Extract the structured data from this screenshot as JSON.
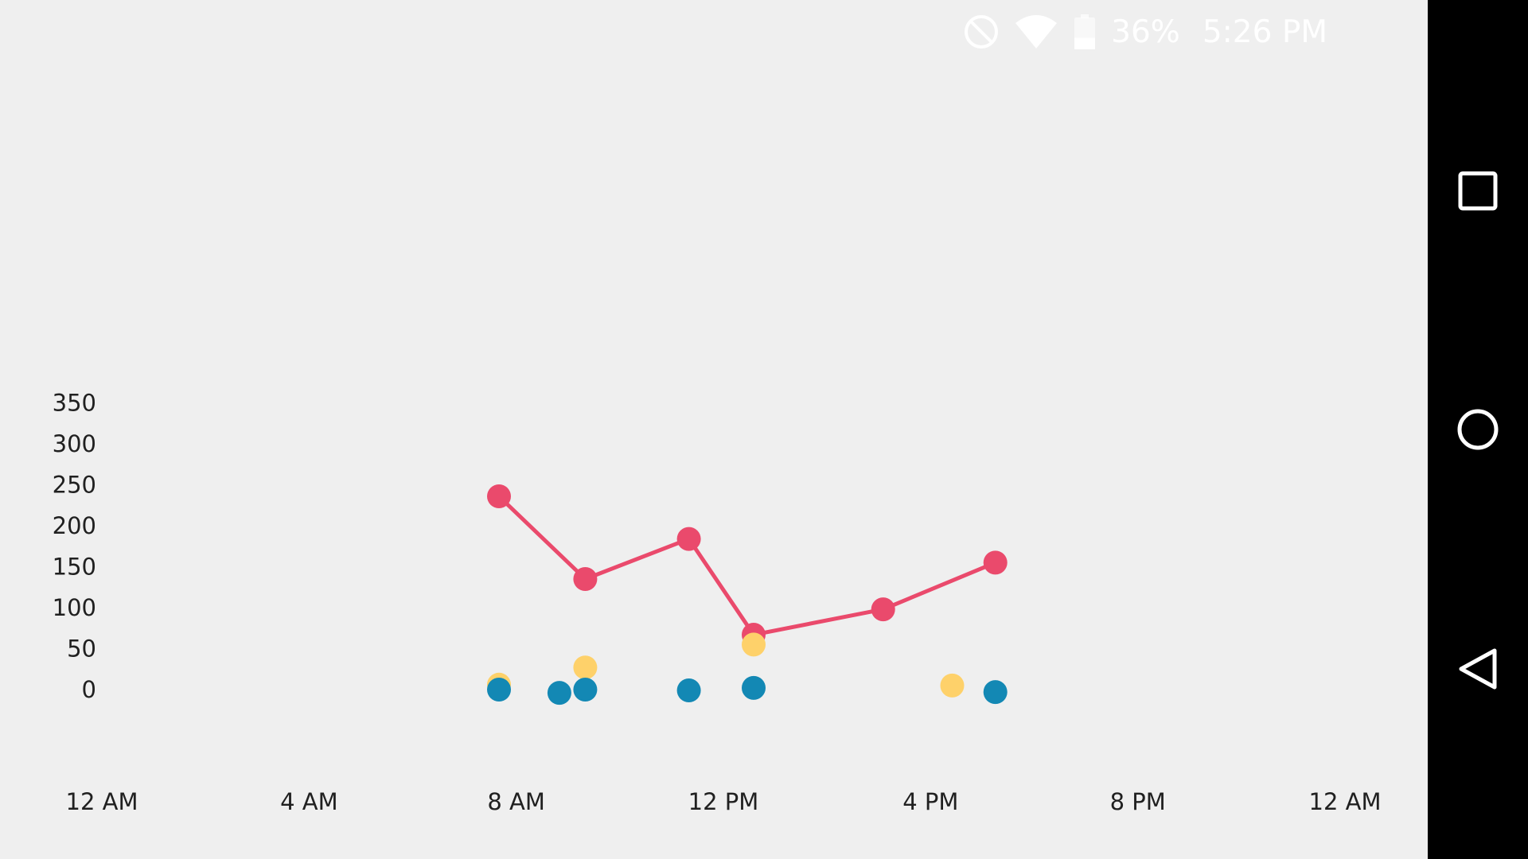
{
  "status_bar": {
    "battery_percent": "36%",
    "time": "5:26 PM",
    "icons": [
      "do-not-disturb-icon",
      "wifi-icon",
      "battery-icon"
    ],
    "battery_level": 0.36
  },
  "nav_bar": {
    "buttons": [
      "recent-apps-icon",
      "home-icon",
      "back-icon"
    ]
  },
  "colors": {
    "background": "#efefef",
    "series_red": "#ea4a6c",
    "series_yellow": "#fed16a",
    "series_blue": "#1388b4",
    "nav_bar": "#000000",
    "text": "#202020"
  },
  "chart_data": {
    "type": "line",
    "title": "",
    "xlabel": "",
    "ylabel": "",
    "x_ticks": [
      "12 AM",
      "4 AM",
      "8 AM",
      "12 PM",
      "4 PM",
      "8 PM",
      "12 AM"
    ],
    "x_tick_hours": [
      0,
      4,
      8,
      12,
      16,
      20,
      24
    ],
    "y_ticks": [
      "350",
      "300",
      "250",
      "200",
      "150",
      "100",
      "50",
      "0"
    ],
    "y_tick_values": [
      350,
      300,
      250,
      200,
      150,
      100,
      50,
      0
    ],
    "xlim_hours": [
      0,
      24
    ],
    "ylim": [
      0,
      350
    ],
    "grid": false,
    "legend": "none",
    "series": [
      {
        "style": "line-markers",
        "color": "#ea4a6c",
        "points": [
          {
            "x": "7:40 AM",
            "y": 236
          },
          {
            "x": "9:20 AM",
            "y": 135
          },
          {
            "x": "11:20 AM",
            "y": 184
          },
          {
            "x": "12:35 PM",
            "y": 67
          },
          {
            "x": "3:05 PM",
            "y": 98
          },
          {
            "x": "5:15 PM",
            "y": 155
          }
        ]
      },
      {
        "style": "markers",
        "color": "#fed16a",
        "points": [
          {
            "x": "7:40 AM",
            "y": 6
          },
          {
            "x": "9:20 AM",
            "y": 27
          },
          {
            "x": "12:35 PM",
            "y": 55
          },
          {
            "x": "4:25 PM",
            "y": 5
          }
        ]
      },
      {
        "style": "markers",
        "color": "#1388b4",
        "points": [
          {
            "x": "7:40 AM",
            "y": 0
          },
          {
            "x": "8:50 AM",
            "y": -4
          },
          {
            "x": "9:20 AM",
            "y": 0
          },
          {
            "x": "11:20 AM",
            "y": -1
          },
          {
            "x": "12:35 PM",
            "y": 2
          },
          {
            "x": "5:15 PM",
            "y": -3
          }
        ]
      }
    ]
  }
}
